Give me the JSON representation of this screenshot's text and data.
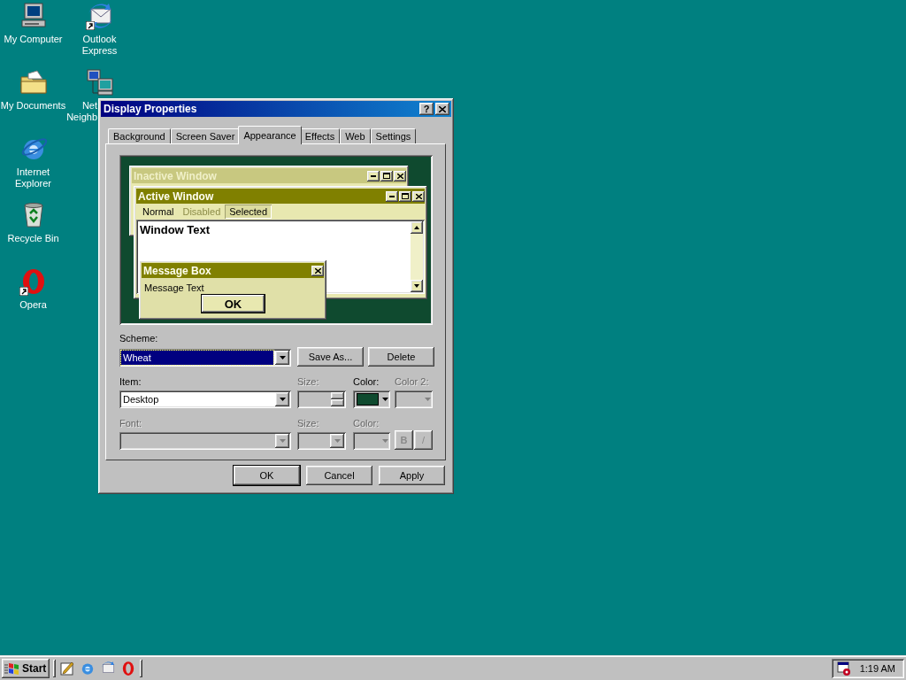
{
  "desktop_icons": [
    {
      "kind": "computer",
      "lines": [
        "My Computer"
      ],
      "shortcut": false,
      "cut": false
    },
    {
      "kind": "folder",
      "lines": [
        "My Documents"
      ],
      "shortcut": false,
      "cut": false
    },
    {
      "kind": "browser",
      "lines": [
        "Internet",
        "Explorer"
      ],
      "shortcut": false,
      "cut": false
    },
    {
      "kind": "bin",
      "lines": [
        "Recycle Bin"
      ],
      "shortcut": false,
      "cut": false
    },
    {
      "kind": "opera",
      "lines": [
        "Opera"
      ],
      "shortcut": true,
      "cut": false
    },
    {
      "kind": "mail",
      "lines": [
        "Outlook",
        "Express"
      ],
      "shortcut": true,
      "cut": false
    },
    {
      "kind": "network",
      "lines": [
        "Net",
        "Neighb"
      ],
      "shortcut": false,
      "cut": true
    }
  ],
  "dialog": {
    "title": "Display Properties",
    "help": "?",
    "tabs": [
      {
        "label": "Background",
        "selected": false
      },
      {
        "label": "Screen Saver",
        "selected": false
      },
      {
        "label": "Appearance",
        "selected": true
      },
      {
        "label": "Effects",
        "selected": false
      },
      {
        "label": "Web",
        "selected": false
      },
      {
        "label": "Settings",
        "selected": false
      }
    ],
    "preview": {
      "inactive_title": "Inactive Window",
      "active_title": "Active Window",
      "menu": [
        {
          "label": "Normal",
          "disabled": false,
          "selected": false
        },
        {
          "label": "Disabled",
          "disabled": true,
          "selected": false
        },
        {
          "label": "Selected",
          "disabled": false,
          "selected": true
        }
      ],
      "window_text": "Window Text",
      "message_title": "Message Box",
      "message_text": "Message Text",
      "message_button": "OK"
    },
    "scheme": {
      "label": "Scheme:",
      "value": "Wheat",
      "buttons": [
        {
          "label": "Save As...",
          "disabled": false
        },
        {
          "label": "Delete",
          "disabled": false
        }
      ]
    },
    "item": {
      "label": "Item:",
      "value": "Desktop",
      "size_label": "Size:",
      "size_disabled": true,
      "color_label": "Color:",
      "color": "#0f4a2f",
      "color2_label": "Color 2:",
      "color2_disabled": true
    },
    "font": {
      "label": "Font:",
      "disabled": true,
      "size_label": "Size:",
      "color_label": "Color:",
      "bold": "B",
      "italic": "/"
    },
    "buttons": [
      "OK",
      "Cancel",
      "Apply"
    ]
  },
  "taskbar": {
    "start": "Start",
    "quick_launch": [
      {
        "kind": "notepad"
      },
      {
        "kind": "browser"
      },
      {
        "kind": "mail"
      },
      {
        "kind": "opera"
      }
    ],
    "time": "1:19 AM"
  }
}
